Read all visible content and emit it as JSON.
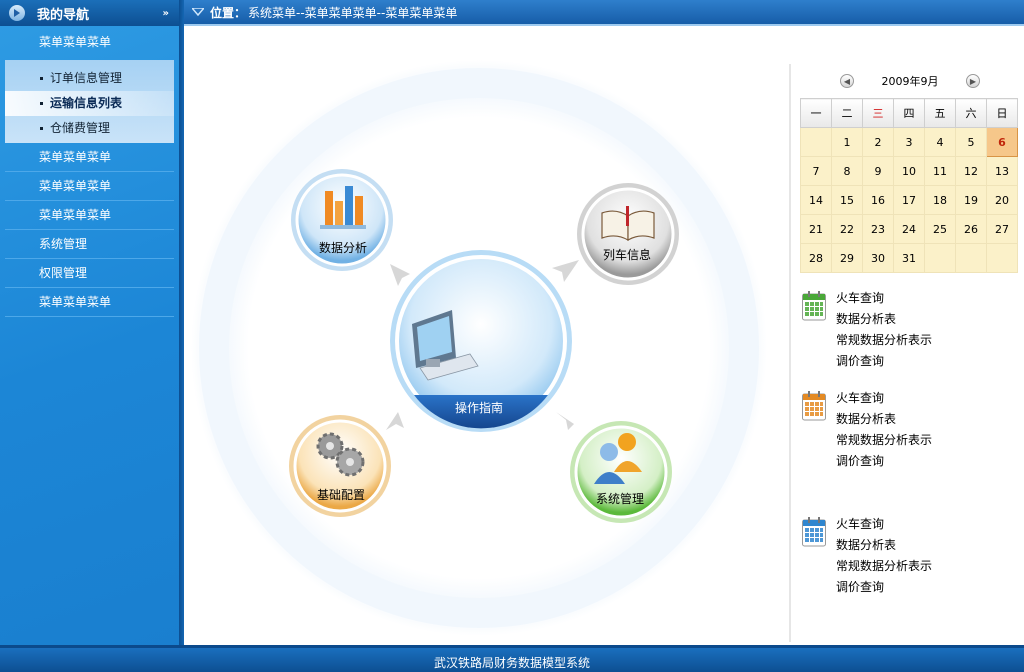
{
  "sidebar": {
    "header_label": "我的导航",
    "group_title": "菜单菜单菜单",
    "sub_items": [
      {
        "label": "订单信息管理",
        "active": false
      },
      {
        "label": "运输信息列表",
        "active": true
      },
      {
        "label": "仓储费管理",
        "active": false
      }
    ],
    "items": [
      {
        "label": "菜单菜单菜单"
      },
      {
        "label": "菜单菜单菜单"
      },
      {
        "label": "菜单菜单菜单"
      },
      {
        "label": "系统管理"
      },
      {
        "label": "权限管理"
      },
      {
        "label": "菜单菜单菜单"
      }
    ]
  },
  "topbar": {
    "location_label": "位置：",
    "path": "系统菜单--菜单菜单菜单--菜单菜单菜单"
  },
  "hub": {
    "center_label": "操作指南",
    "nodes": {
      "data_analysis": "数据分析",
      "train_info": "列车信息",
      "base_config": "基础配置",
      "system_admin": "系统管理"
    }
  },
  "calendar": {
    "month_label": "2009年9月",
    "weekdays": [
      "一",
      "二",
      "三",
      "四",
      "五",
      "六",
      "日"
    ],
    "highlight_weekday_index": 2,
    "today": "6",
    "weeks": [
      [
        "",
        "1",
        "2",
        "3",
        "4",
        "5",
        "6"
      ],
      [
        "7",
        "8",
        "9",
        "10",
        "11",
        "12",
        "13"
      ],
      [
        "14",
        "15",
        "16",
        "17",
        "18",
        "19",
        "20"
      ],
      [
        "21",
        "22",
        "23",
        "24",
        "25",
        "26",
        "27"
      ],
      [
        "28",
        "29",
        "30",
        "31",
        "",
        "",
        ""
      ]
    ]
  },
  "link_groups": [
    {
      "icon": "calendar-green-icon",
      "color": "#4aa838",
      "links": [
        "火车查询",
        "数据分析表",
        "常规数据分析表示",
        "调价查询"
      ]
    },
    {
      "icon": "calendar-orange-icon",
      "color": "#e48a23",
      "links": [
        "火车查询",
        "数据分析表",
        "常规数据分析表示",
        "调价查询"
      ]
    },
    {
      "icon": "calendar-blue-icon",
      "color": "#2f86cf",
      "links": [
        "火车查询",
        "数据分析表",
        "常规数据分析表示",
        "调价查询"
      ]
    }
  ],
  "footer": {
    "text": "武汉铁路局财务数据模型系统"
  },
  "colors": {
    "sidebar_bg": "#1c86d6",
    "header_bg": "#165da8",
    "calendar_cell": "#fbf1c9",
    "today_cell": "#f6c78a",
    "weekday_highlight": "#d21d1d"
  }
}
